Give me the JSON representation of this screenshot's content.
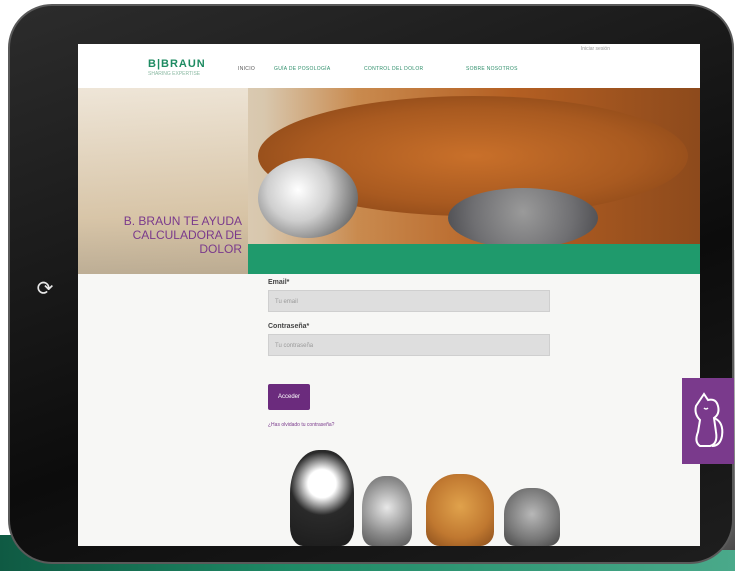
{
  "nav": {
    "logo": "B|BRAUN",
    "logo_sub": "SHARING EXPERTISE",
    "items": [
      {
        "label": "INICIO"
      },
      {
        "label": "GUÍA DE POSOLOGÍA"
      },
      {
        "label": "CONTROL DEL DOLOR"
      },
      {
        "label": "SOBRE NOSOTROS"
      }
    ],
    "top_link": "Iniciar sesión"
  },
  "hero": {
    "line1": "B. BRAUN TE AYUDA",
    "line2": "CALCULADORA DE DOLOR"
  },
  "form": {
    "email_label": "Email*",
    "email_placeholder": "Tu email",
    "password_label": "Contraseña*",
    "password_placeholder": "Tu contraseña",
    "submit_label": "Acceder",
    "forgot_link": "¿Has olvidado tu contraseña?"
  },
  "colors": {
    "brand_green": "#1f9a6c",
    "brand_purple": "#6b2b7d"
  },
  "icons": {
    "home": "refresh-icon",
    "badge": "dog-cat-outline-icon"
  }
}
